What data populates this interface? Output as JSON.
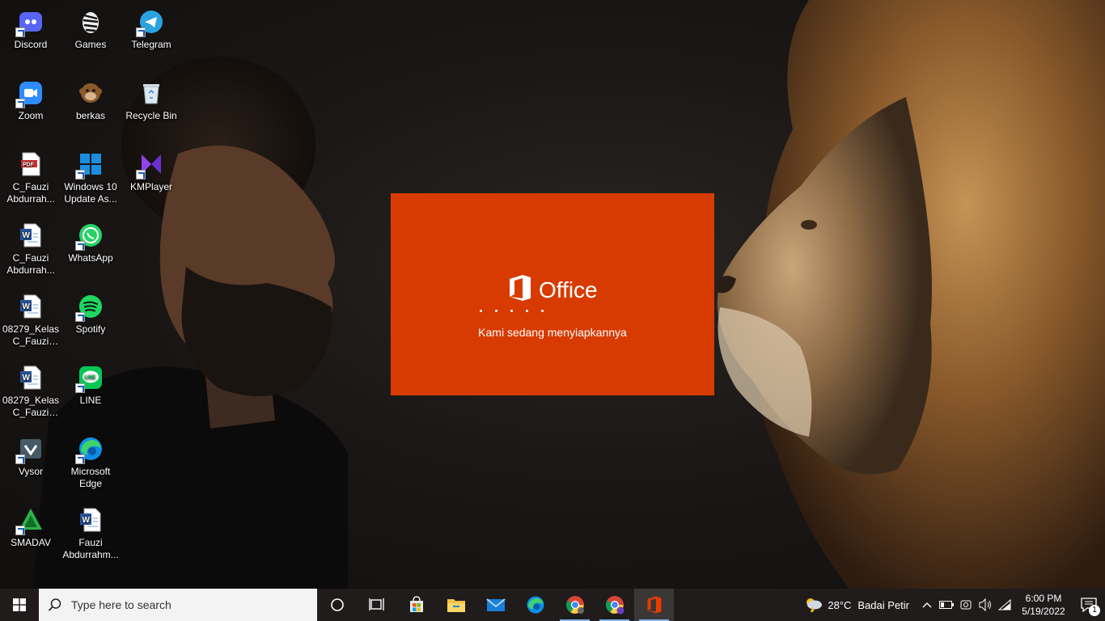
{
  "desktop": {
    "icons": [
      {
        "label": "Discord",
        "icon": "discord-icon"
      },
      {
        "label": "Games",
        "icon": "zebra-icon"
      },
      {
        "label": "Telegram",
        "icon": "telegram-icon"
      },
      {
        "label": "Zoom",
        "icon": "zoom-icon"
      },
      {
        "label": "berkas",
        "icon": "monkey-icon"
      },
      {
        "label": "Recycle Bin",
        "icon": "recycle-bin-icon"
      },
      {
        "label": "C_Fauzi Abdurrah...",
        "icon": "pdf-icon"
      },
      {
        "label": "Windows 10 Update As...",
        "icon": "windows-update-icon"
      },
      {
        "label": "KMPlayer",
        "icon": "kmplayer-icon"
      },
      {
        "label": "C_Fauzi Abdurrah...",
        "icon": "word-doc-icon"
      },
      {
        "label": "WhatsApp",
        "icon": "whatsapp-icon"
      },
      {
        "label": "08279_Kelas C_Fauzi Ab...",
        "icon": "word-doc-icon"
      },
      {
        "label": "Spotify",
        "icon": "spotify-icon"
      },
      {
        "label": "08279_Kelas C_Fauzi Ab...",
        "icon": "word-doc-icon"
      },
      {
        "label": "LINE",
        "icon": "line-icon"
      },
      {
        "label": "Vysor",
        "icon": "vysor-icon"
      },
      {
        "label": "Microsoft Edge",
        "icon": "edge-icon"
      },
      {
        "label": "SMADAV",
        "icon": "smadav-icon"
      },
      {
        "label": "Fauzi Abdurrahm...",
        "icon": "word-doc-icon"
      }
    ]
  },
  "splash": {
    "product": "Office",
    "message": "Kami sedang menyiapkannya",
    "bg_color": "#d83b01"
  },
  "taskbar": {
    "search_placeholder": "Type here to search",
    "apps": [
      "cortana-icon",
      "task-view-icon",
      "microsoft-store-icon",
      "file-explorer-icon",
      "mail-icon",
      "edge-icon",
      "chrome-icon",
      "chrome-profile-icon",
      "office-icon"
    ],
    "weather": {
      "temp": "28°C",
      "condition": "Badai Petir"
    },
    "clock": {
      "time": "6:00 PM",
      "date": "5/19/2022"
    },
    "notification_count": "1"
  }
}
